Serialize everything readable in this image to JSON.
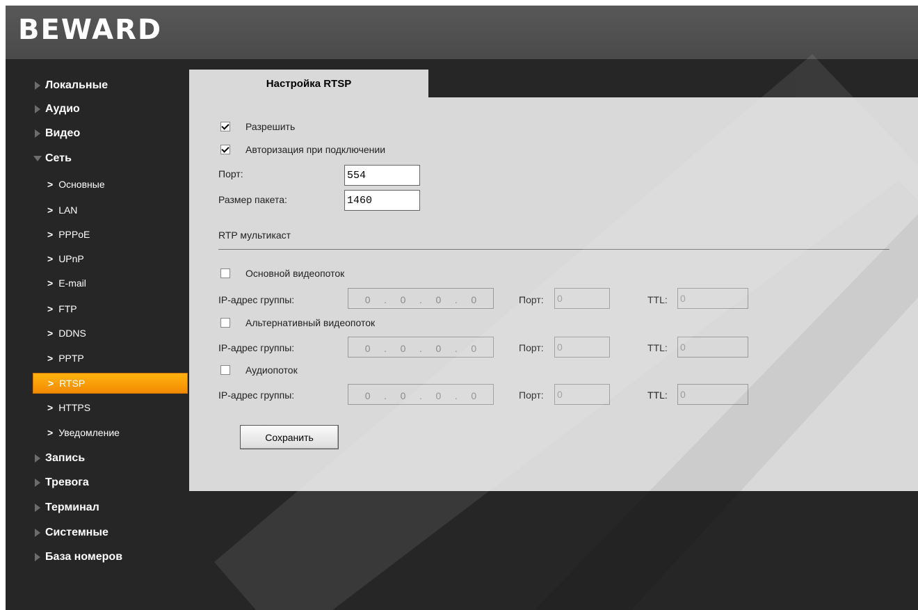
{
  "brand": {
    "logo_text": "BEWARD"
  },
  "sidebar": {
    "top_items": [
      {
        "label": "Локальные"
      },
      {
        "label": "Аудио"
      },
      {
        "label": "Видео"
      },
      {
        "label": "Сеть",
        "expanded": true
      },
      {
        "label": "Запись"
      },
      {
        "label": "Тревога"
      },
      {
        "label": "Терминал"
      },
      {
        "label": "Системные"
      },
      {
        "label": "База номеров"
      }
    ],
    "network_sub_items": [
      {
        "label": "Основные"
      },
      {
        "label": "LAN"
      },
      {
        "label": "PPPoE"
      },
      {
        "label": "UPnP"
      },
      {
        "label": "E-mail"
      },
      {
        "label": "FTP"
      },
      {
        "label": "DDNS"
      },
      {
        "label": "PPTP"
      },
      {
        "label": "RTSP",
        "active": true
      },
      {
        "label": "HTTPS"
      },
      {
        "label": "Уведомление"
      }
    ],
    "active_color": "#f7a000"
  },
  "main": {
    "tab_title": "Настройка RTSP",
    "enable": {
      "label": "Разрешить",
      "checked": true
    },
    "auth": {
      "label": "Авторизация при подключении",
      "checked": true
    },
    "port": {
      "label": "Порт:",
      "value": "554"
    },
    "packet_size": {
      "label": "Размер пакета:",
      "value": "1460"
    },
    "multicast_title": "RTP мультикаст",
    "streams": [
      {
        "label": "Основной видеопоток",
        "checked": false,
        "ip_label": "IP-адрес группы:",
        "ip": [
          "0",
          "0",
          "0",
          "0"
        ],
        "port_label": "Порт:",
        "port": "0",
        "ttl_label": "TTL:",
        "ttl": "0"
      },
      {
        "label": "Альтернативный видеопоток",
        "checked": false,
        "ip_label": "IP-адрес группы:",
        "ip": [
          "0",
          "0",
          "0",
          "0"
        ],
        "port_label": "Порт:",
        "port": "0",
        "ttl_label": "TTL:",
        "ttl": "0"
      },
      {
        "label": "Аудиопоток",
        "checked": false,
        "ip_label": "IP-адрес группы:",
        "ip": [
          "0",
          "0",
          "0",
          "0"
        ],
        "port_label": "Порт:",
        "port": "0",
        "ttl_label": "TTL:",
        "ttl": "0"
      }
    ],
    "save_label": "Сохранить",
    "ip_separator": "."
  }
}
